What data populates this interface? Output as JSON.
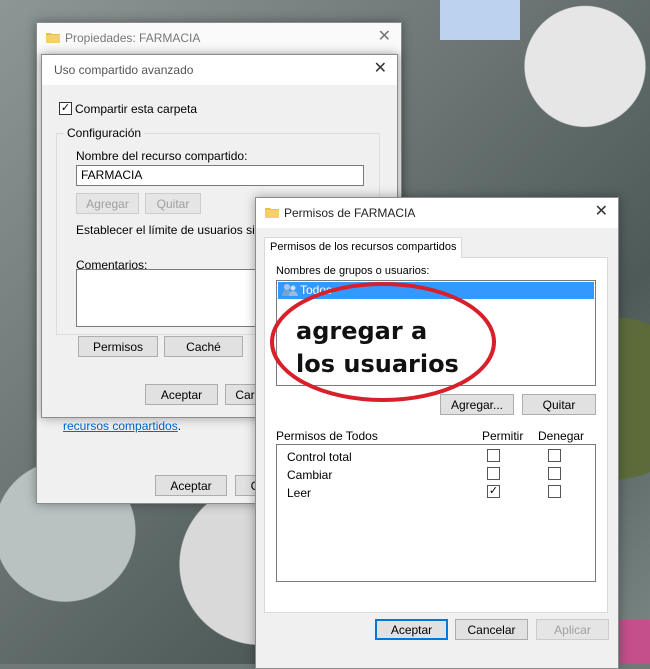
{
  "propiedades": {
    "title": "Propiedades: FARMACIA",
    "link_text": "recursos compartidos",
    "link_suffix": ".",
    "aceptar": "Aceptar",
    "cancelar_partial": "C"
  },
  "uso_compartido": {
    "title": "Uso compartido avanzado",
    "share_checkbox_label": "Compartir esta carpeta",
    "share_checked": true,
    "config_group": "Configuración",
    "share_name_label": "Nombre del recurso compartido:",
    "share_name_value": "FARMACIA",
    "agregar": "Agregar",
    "quitar": "Quitar",
    "limit_label": "Establecer el límite de usuarios simulta",
    "comments_label": "Comentarios:",
    "permisos": "Permisos",
    "cache": "Caché",
    "aceptar": "Aceptar",
    "cancelar_partial": "Car"
  },
  "permisos": {
    "title": "Permisos de FARMACIA",
    "tab": "Permisos de los recursos compartidos",
    "groups_label": "Nombres de grupos o usuarios:",
    "groups": [
      "Todos"
    ],
    "annotation": "agregar a los usuarios",
    "agregar": "Agregar...",
    "quitar": "Quitar",
    "perm_header": "Permisos de Todos",
    "col_allow": "Permitir",
    "col_deny": "Denegar",
    "rows": [
      {
        "name": "Control total",
        "allow": false,
        "deny": false
      },
      {
        "name": "Cambiar",
        "allow": false,
        "deny": false
      },
      {
        "name": "Leer",
        "allow": true,
        "deny": false
      }
    ],
    "aceptar": "Aceptar",
    "cancelar": "Cancelar",
    "aplicar": "Aplicar"
  },
  "colors": {
    "accent": "#0078d7",
    "annotation_red": "#d8202a",
    "selection": "#3399ff"
  }
}
